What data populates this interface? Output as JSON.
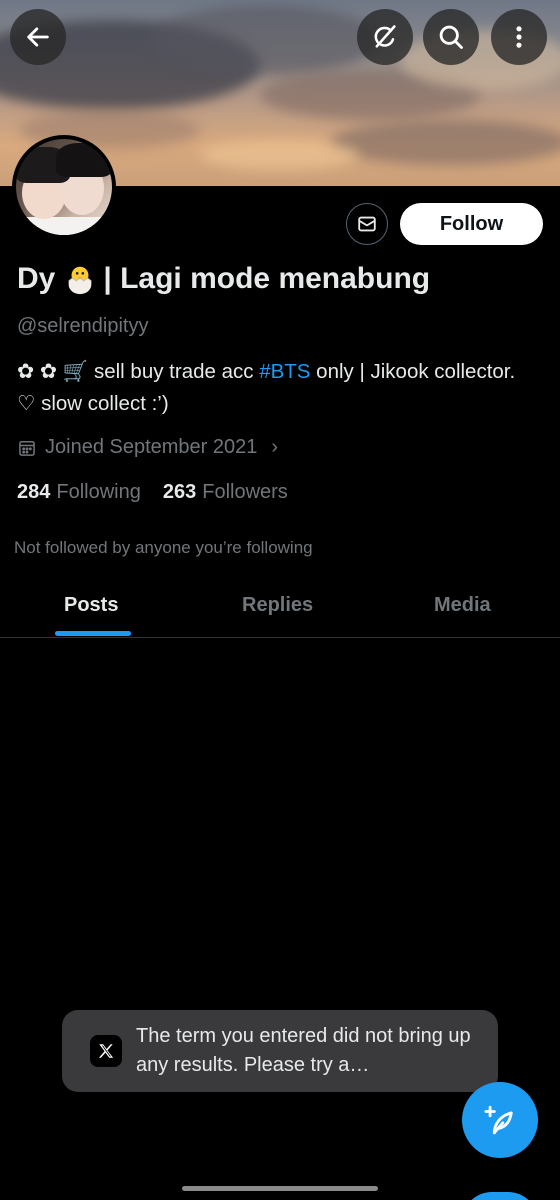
{
  "header": {
    "back_icon": "arrow-left-icon",
    "grok_icon": "grok-icon",
    "search_icon": "search-icon",
    "more_icon": "more-vertical-icon"
  },
  "profile": {
    "display_name_start": "Dy",
    "display_name_emoji": "hatching-chick-icon",
    "display_name_end": "| Lagi mode menabung",
    "handle": "@selrendipityy",
    "bio_before_hashtag": "✿ ✿ 🛒 sell buy trade acc ",
    "bio_hashtag": "#BTS",
    "bio_after_hashtag": " only | Jikook collector. ♡ slow collect :’)",
    "joined": "Joined September 2021",
    "joined_chevron": "›",
    "following_count": "284",
    "following_label": "Following",
    "followers_count": "263",
    "followers_label": "Followers",
    "not_followed_note": "Not followed by anyone you’re following"
  },
  "actions": {
    "message_icon": "envelope-icon",
    "follow_label": "Follow"
  },
  "tabs": [
    {
      "label": "Posts",
      "active": true
    },
    {
      "label": "Replies",
      "active": false
    },
    {
      "label": "Media",
      "active": false
    }
  ],
  "toast": {
    "text": "The term you entered did not bring up any results. Please try a…"
  },
  "fab": {
    "icon": "compose-feather-icon"
  },
  "colors": {
    "accent": "#1d9bf0",
    "background": "#000000",
    "secondary_text": "#71767b"
  }
}
